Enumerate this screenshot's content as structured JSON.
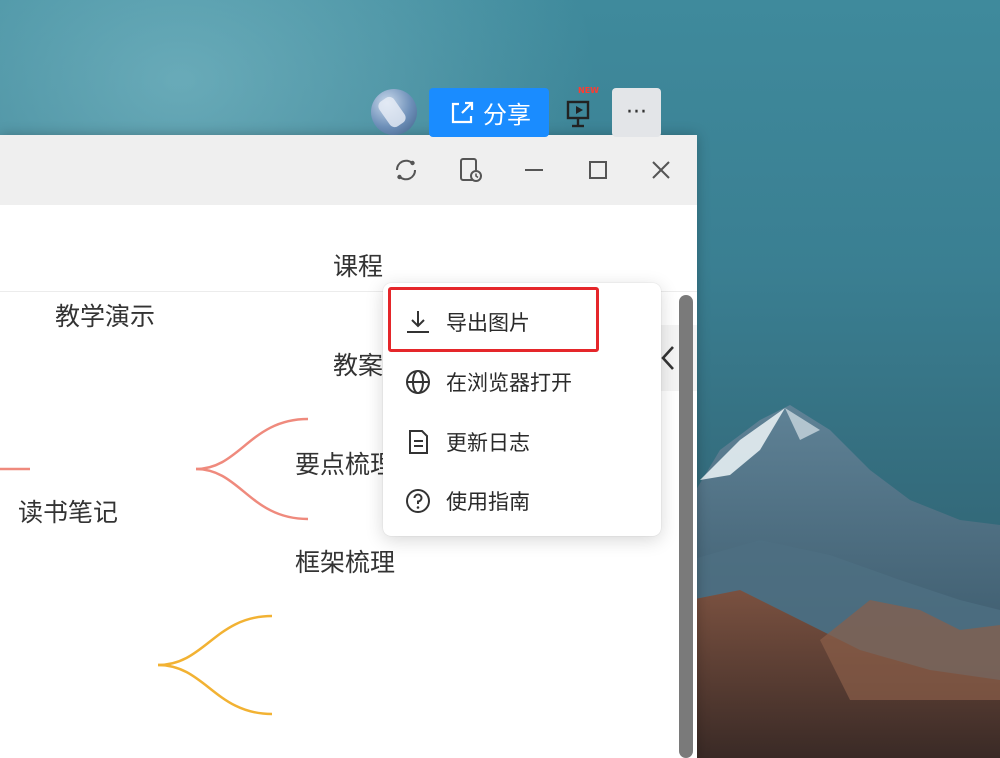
{
  "toolbar": {
    "share_label": "分享",
    "new_badge": "NEW",
    "more_label": "···"
  },
  "mindmap": {
    "nodes": {
      "teaching_demo": "教学演示",
      "course": "课程",
      "lesson_plan": "教案",
      "reading_notes": "读书笔记",
      "key_points": "要点梳理",
      "framework": "框架梳理"
    },
    "branch_colors": {
      "teaching": "#ef8a7d",
      "reading": "#f2b233"
    }
  },
  "dropdown_menu": {
    "items": [
      {
        "label": "导出图片",
        "icon": "download-icon"
      },
      {
        "label": "在浏览器打开",
        "icon": "globe-icon"
      },
      {
        "label": "更新日志",
        "icon": "document-icon"
      },
      {
        "label": "使用指南",
        "icon": "help-circle-icon"
      }
    ],
    "highlighted_index": 0,
    "highlight_color": "#e5262a"
  },
  "colors": {
    "accent": "#1a8cff",
    "titlebar": "#efefef"
  }
}
